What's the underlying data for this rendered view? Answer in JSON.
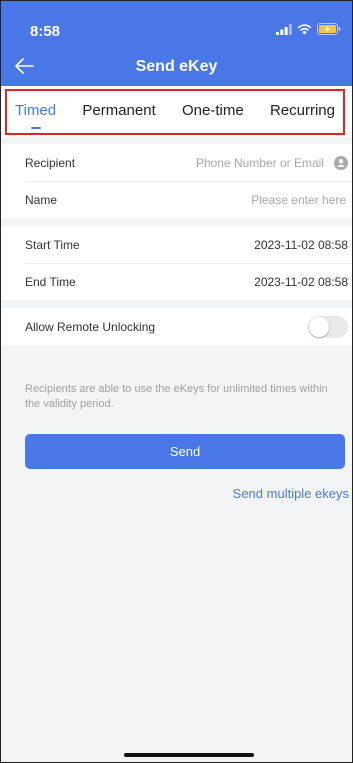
{
  "status_bar": {
    "time": "8:58",
    "icons": [
      "signal-icon",
      "wifi-icon",
      "battery-charging-icon"
    ]
  },
  "nav": {
    "title": "Send eKey",
    "back_icon": "back-arrow-icon"
  },
  "tabs": [
    {
      "label": "Timed",
      "active": true
    },
    {
      "label": "Permanent",
      "active": false
    },
    {
      "label": "One-time",
      "active": false
    },
    {
      "label": "Recurring",
      "active": false
    }
  ],
  "form": {
    "recipient": {
      "label": "Recipient",
      "placeholder": "Phone Number or Email",
      "icon": "contact-icon"
    },
    "name": {
      "label": "Name",
      "placeholder": "Please enter here"
    },
    "start_time": {
      "label": "Start Time",
      "value": "2023-11-02 08:58"
    },
    "end_time": {
      "label": "End Time",
      "value": "2023-11-02 08:58"
    },
    "remote_unlocking": {
      "label": "Allow Remote Unlocking",
      "enabled": false
    }
  },
  "info_text": "Recipients are able to use the eKeys for unlimited times within the validity period.",
  "send_button": "Send",
  "send_multiple": "Send multiple ekeys",
  "colors": {
    "accent": "#4a77e8",
    "highlight_border": "#e0242b",
    "background_gap": "#f3f4f6"
  }
}
